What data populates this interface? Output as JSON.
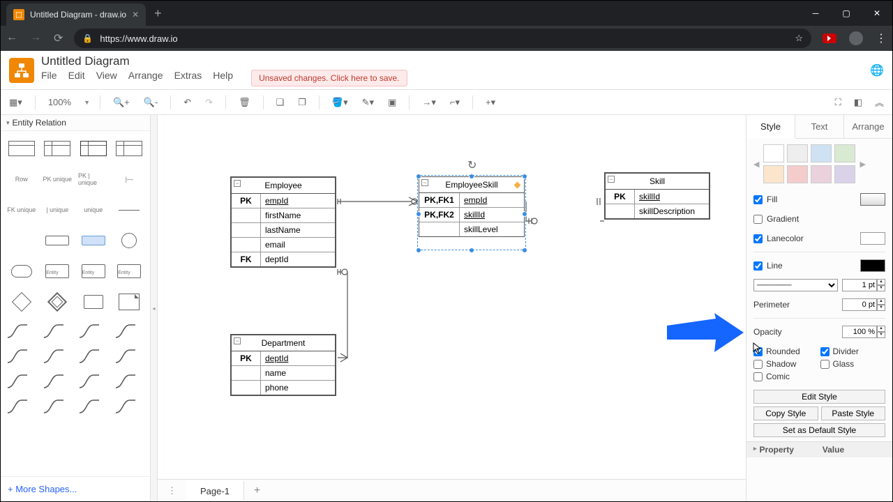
{
  "browser": {
    "tab_title": "Untitled Diagram - draw.io",
    "url": "https://www.draw.io"
  },
  "app": {
    "title": "Untitled Diagram",
    "menus": [
      "File",
      "Edit",
      "View",
      "Arrange",
      "Extras",
      "Help"
    ],
    "save_warning": "Unsaved changes. Click here to save.",
    "zoom": "100%"
  },
  "palette": {
    "title": "Entity Relation",
    "row_label": "Row",
    "more": "+ More Shapes..."
  },
  "canvas": {
    "entities": {
      "employee": {
        "title": "Employee",
        "rows": [
          {
            "key": "PK",
            "col": "empId",
            "u": true
          },
          {
            "key": "",
            "col": "firstName"
          },
          {
            "key": "",
            "col": "lastName"
          },
          {
            "key": "",
            "col": "email"
          },
          {
            "key": "FK",
            "col": "deptId"
          }
        ]
      },
      "employeeSkill": {
        "title": "EmployeeSkill",
        "rows": [
          {
            "key": "PK,FK1",
            "col": "empId",
            "u": true
          },
          {
            "key": "PK,FK2",
            "col": "skillId",
            "u": true
          },
          {
            "key": "",
            "col": "skillLevel"
          }
        ]
      },
      "skill": {
        "title": "Skill",
        "rows": [
          {
            "key": "PK",
            "col": "skillId",
            "u": true
          },
          {
            "key": "",
            "col": "skillDescription"
          }
        ]
      },
      "department": {
        "title": "Department",
        "rows": [
          {
            "key": "PK",
            "col": "deptId",
            "u": true
          },
          {
            "key": "",
            "col": "name"
          },
          {
            "key": "",
            "col": "phone"
          }
        ]
      }
    }
  },
  "pages": {
    "current": "Page-1"
  },
  "style_panel": {
    "tabs": [
      "Style",
      "Text",
      "Arrange"
    ],
    "swatches": [
      "#ffffff",
      "#eeeeee",
      "#cfe2f3",
      "#d9ead3",
      "#fce5cd",
      "#f4cccc",
      "#ead1dc",
      "#d9d2e9"
    ],
    "fill": {
      "label": "Fill",
      "checked": true,
      "color": "#ffffff",
      "grad": "linear-gradient(#fff,#ddd)"
    },
    "gradient": {
      "label": "Gradient",
      "checked": false
    },
    "lanecolor": {
      "label": "Lanecolor",
      "checked": true,
      "color": "#ffffff"
    },
    "line": {
      "label": "Line",
      "checked": true,
      "color": "#000000",
      "width": "1 pt"
    },
    "perimeter": {
      "label": "Perimeter",
      "value": "0 pt"
    },
    "opacity": {
      "label": "Opacity",
      "value": "100 %"
    },
    "rounded": {
      "label": "Rounded",
      "checked": true
    },
    "divider": {
      "label": "Divider",
      "checked": true
    },
    "shadow": {
      "label": "Shadow",
      "checked": false
    },
    "glass": {
      "label": "Glass",
      "checked": false
    },
    "comic": {
      "label": "Comic",
      "checked": false
    },
    "buttons": {
      "edit": "Edit Style",
      "copy": "Copy Style",
      "paste": "Paste Style",
      "default": "Set as Default Style"
    },
    "kv": {
      "prop": "Property",
      "val": "Value"
    }
  }
}
